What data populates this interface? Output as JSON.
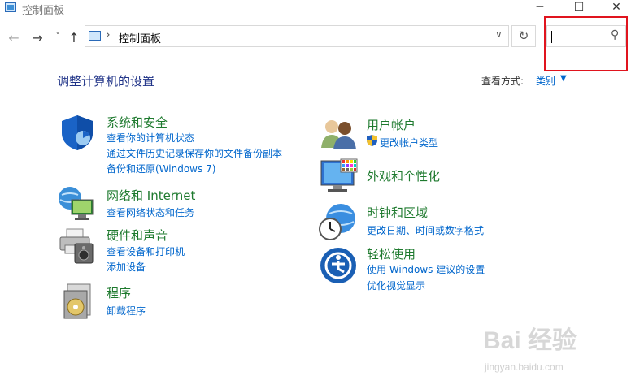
{
  "window": {
    "title": "控制面板",
    "minimize": "─",
    "maximize": "☐",
    "close": "✕"
  },
  "nav": {
    "back": "←",
    "forward": "→",
    "recent": "˅",
    "up": "↑"
  },
  "address": {
    "separator": "›",
    "path": "控制面板",
    "dropdown": "∨",
    "refresh": "↻"
  },
  "search": {
    "icon": "⚲",
    "value": ""
  },
  "heading": "调整计算机的设置",
  "view": {
    "label": "查看方式:",
    "value": "类别",
    "arrow": "▼"
  },
  "categories": [
    {
      "title": "系统和安全",
      "icon": "shield-icon",
      "links": [
        "查看你的计算机状态",
        "通过文件历史记录保存你的文件备份副本",
        "备份和还原(Windows 7)"
      ]
    },
    {
      "title": "网络和 Internet",
      "icon": "network-globe-icon",
      "links": [
        "查看网络状态和任务"
      ]
    },
    {
      "title": "硬件和声音",
      "icon": "printer-speaker-icon",
      "links": [
        "查看设备和打印机",
        "添加设备"
      ]
    },
    {
      "title": "程序",
      "icon": "programs-icon",
      "links": [
        "卸载程序"
      ]
    },
    {
      "title": "用户帐户",
      "icon": "users-icon",
      "links": [
        "更改帐户类型"
      ]
    },
    {
      "title": "外观和个性化",
      "icon": "monitor-palette-icon",
      "links": []
    },
    {
      "title": "时钟和区域",
      "icon": "clock-globe-icon",
      "links": [
        "更改日期、时间或数字格式"
      ]
    },
    {
      "title": "轻松使用",
      "icon": "ease-of-access-icon",
      "links": [
        "使用 Windows 建议的设置",
        "优化视觉显示"
      ]
    }
  ],
  "watermark": {
    "brand": "Bai 经验",
    "url": "jingyan.baidu.com"
  },
  "colors": {
    "category_title": "#1e7a2e",
    "link": "#0066cc",
    "heading": "#1e3287",
    "highlight_box": "#e0141e"
  }
}
